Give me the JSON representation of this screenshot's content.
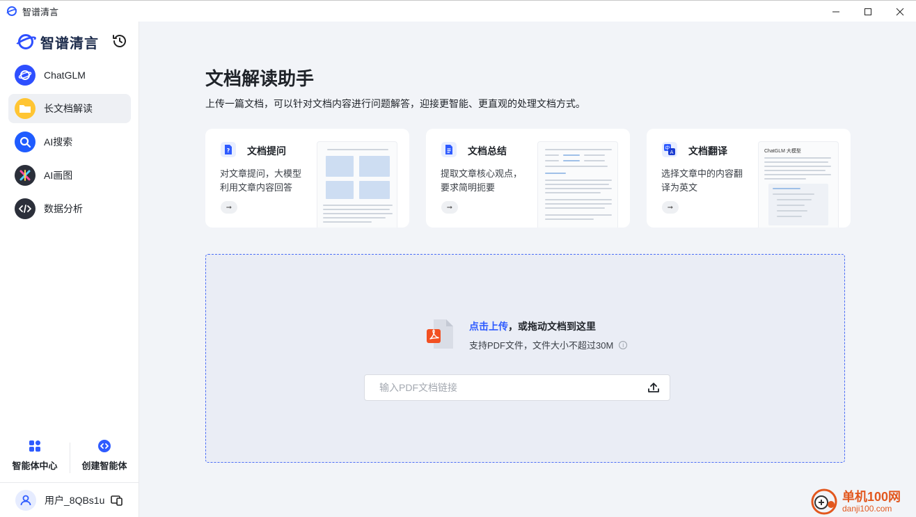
{
  "window": {
    "title": "智谱清言",
    "controls": [
      "minimize",
      "maximize",
      "close"
    ]
  },
  "sidebar": {
    "logo_text": "智谱清言",
    "items": [
      {
        "label": "ChatGLM",
        "icon": "chatglm-icon",
        "active": false
      },
      {
        "label": "长文档解读",
        "icon": "document-folder-icon",
        "active": true
      },
      {
        "label": "AI搜索",
        "icon": "search-icon",
        "active": false
      },
      {
        "label": "AI画图",
        "icon": "paint-icon",
        "active": false
      },
      {
        "label": "数据分析",
        "icon": "code-icon",
        "active": false
      }
    ],
    "tools": [
      {
        "label": "智能体中心",
        "icon": "agent-center-icon"
      },
      {
        "label": "创建智能体",
        "icon": "create-agent-icon"
      }
    ],
    "user": {
      "name": "用户_8QBs1u"
    }
  },
  "main": {
    "title": "文档解读助手",
    "subtitle": "上传一篇文档，可以针对文档内容进行问题解答，迎接更智能、更直观的处理文档方式。",
    "cards": [
      {
        "title": "文档提问",
        "desc": "对文章提问，大模型利用文章内容回答",
        "icon": "question-doc-icon"
      },
      {
        "title": "文档总结",
        "desc": "提取文章核心观点，要求简明扼要",
        "icon": "summary-doc-icon"
      },
      {
        "title": "文档翻译",
        "desc": "选择文章中的内容翻译为英文",
        "icon": "translate-icon",
        "thumb_title": "ChatGLM 大模型"
      }
    ],
    "upload": {
      "link_text": "点击上传",
      "rest_text": "，或拖动文档到这里",
      "hint": "支持PDF文件，文件大小不超过30M",
      "url_placeholder": "输入PDF文档链接",
      "url_value": ""
    }
  },
  "watermark": {
    "line1": "单机100网",
    "line2": "danji100.com"
  },
  "colors": {
    "accent": "#2e5bff",
    "background": "#f2f4f8",
    "pdf": "#f25022"
  }
}
